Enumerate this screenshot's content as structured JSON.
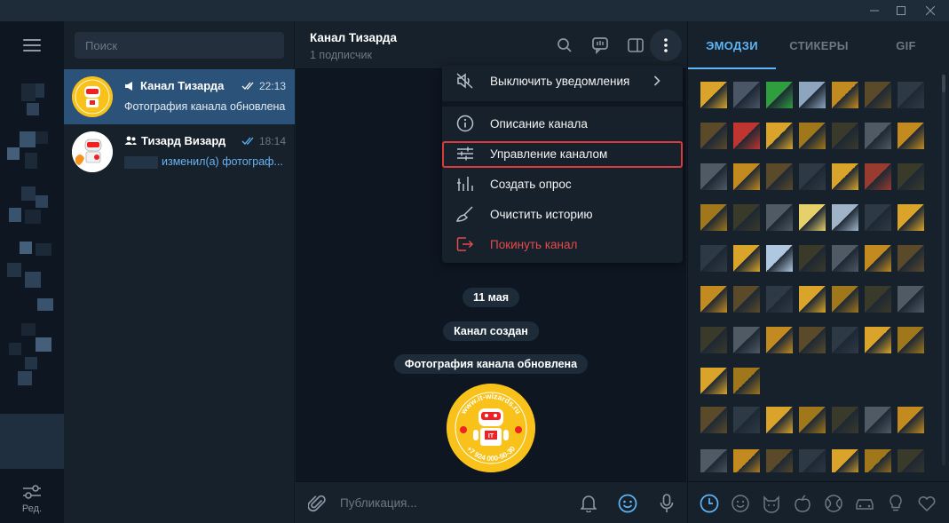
{
  "window": {
    "minimize_icon": "minimize-icon",
    "maximize_icon": "maximize-icon",
    "close_icon": "close-icon"
  },
  "rail": {
    "edit_label": "Ред."
  },
  "search": {
    "placeholder": "Поиск"
  },
  "chats": [
    {
      "title": "Канал Тизарда",
      "time": "22:13",
      "preview": "Фотография канала обновлена",
      "type": "channel",
      "read": true
    },
    {
      "title": "Тизард Визард",
      "time": "18:14",
      "preview": "изменил(а) фотограф...",
      "type": "group",
      "read": true
    }
  ],
  "header": {
    "title": "Канал Тизарда",
    "subtitle": "1 подписчик"
  },
  "messages": {
    "date": "11 мая",
    "service_1": "Канал создан",
    "service_2": "Фотография канала обновлена"
  },
  "channel_photo": {
    "url_text": "www.it-wizards.ru",
    "phone_text": "+7 924 000-50-30",
    "badge": "IT"
  },
  "composer": {
    "placeholder": "Публикация..."
  },
  "menu": {
    "items": [
      {
        "label": "Выключить уведомления",
        "icon": "mute-icon",
        "has_arrow": true
      },
      {
        "label": "Описание канала",
        "icon": "info-icon"
      },
      {
        "label": "Управление каналом",
        "icon": "sliders-icon",
        "highlighted": true
      },
      {
        "label": "Создать опрос",
        "icon": "poll-icon"
      },
      {
        "label": "Очистить историю",
        "icon": "broom-icon"
      },
      {
        "label": "Покинуть канал",
        "icon": "leave-icon",
        "danger": true
      }
    ]
  },
  "emoji_panel": {
    "tabs": [
      {
        "label": "ЭМОДЗИ",
        "active": true
      },
      {
        "label": "СТИКЕРЫ",
        "active": false
      },
      {
        "label": "GIF",
        "active": false
      }
    ]
  },
  "colors": {
    "accent": "#5eb5f7",
    "active_chat": "#2b5278",
    "danger": "#e54b4b",
    "highlight_border": "#d93a3a",
    "avatar_yellow": "#f8c21a"
  }
}
